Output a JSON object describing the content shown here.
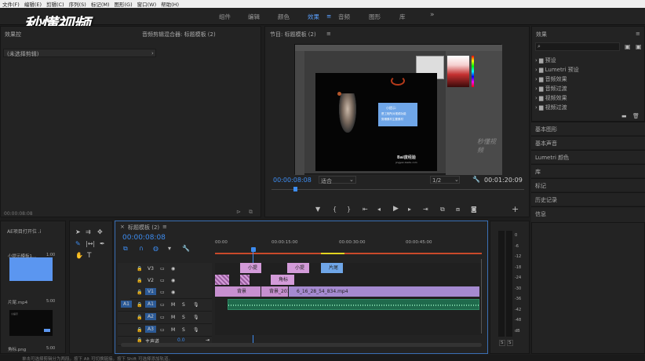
{
  "menu": [
    "文件(F)",
    "编辑(E)",
    "剪辑(C)",
    "序列(S)",
    "标记(M)",
    "图形(G)",
    "窗口(W)",
    "帮助(H)"
  ],
  "workspaces": [
    "组件",
    "编辑",
    "颜色",
    "效果",
    "音频",
    "图形",
    "库"
  ],
  "workspace_active": "效果",
  "workspace_more": "»",
  "watermark": "秒懂视频",
  "source": {
    "tab1": "效果控",
    "tab2": "音频剪辑混合器: 标题模板 (2)",
    "no_clip": "(未选择剪辑)",
    "timecode": "00:00:08:08"
  },
  "program": {
    "title": "节目: 标题模板 (2)",
    "timecode": "00:00:08:08",
    "fit": "适合",
    "quality": "1/2",
    "duration": "00:01:20:09",
    "caption_line1": "小提示:",
    "caption_line2": "是工程所对视频功能",
    "caption_line3": "剪辑素材主要素材",
    "logo": "Bai度经验",
    "logo_sub": "jingyan.baidu.com",
    "ps_text": "秒懂视频"
  },
  "effects": {
    "title": "效果",
    "items": [
      "预设",
      "Lumetri 预设",
      "音频效果",
      "音频过渡",
      "视频效果",
      "视频过渡"
    ],
    "sections": [
      "基本图形",
      "基本声音",
      "Lumetri 颜色",
      "库",
      "标记",
      "历史记录",
      "信息"
    ]
  },
  "project": {
    "title": "AE项目打开位 .i",
    "item1_label": "小提示模板1...",
    "item1_dur": "1:00",
    "item2_label": "片尾.mp4",
    "item2_dur": "5:00",
    "item3_label": "角标.png",
    "item3_dur": "5:00",
    "thumb_text": "小提示"
  },
  "timeline": {
    "title": "标题模板 (2)",
    "timecode": "00:00:08:08",
    "ruler": [
      "00:00",
      "00:00:15:00",
      "00:00:30:00",
      "00:00:45:00"
    ],
    "tracks_v": [
      "V3",
      "V2",
      "V1"
    ],
    "tracks_a": [
      "A1",
      "A2",
      "A3"
    ],
    "source_v": "V1",
    "source_a": "A1",
    "master": "主声道",
    "master_val": "0.0",
    "clips": [
      "小提",
      "小提",
      "片尾",
      "角标",
      "背景",
      "背景_2019_",
      "6_16_28_54_834.mp4"
    ]
  },
  "meter": {
    "left": "S",
    "right": "S",
    "scale": [
      "0",
      "-6",
      "-12",
      "-18",
      "-24",
      "-30",
      "-36",
      "-42",
      "-48",
      "dB"
    ]
  },
  "status": "单击可选择剪辑分为两段。按下 Alt 可切换链接。按下 Shift 可选择添加轨道。"
}
